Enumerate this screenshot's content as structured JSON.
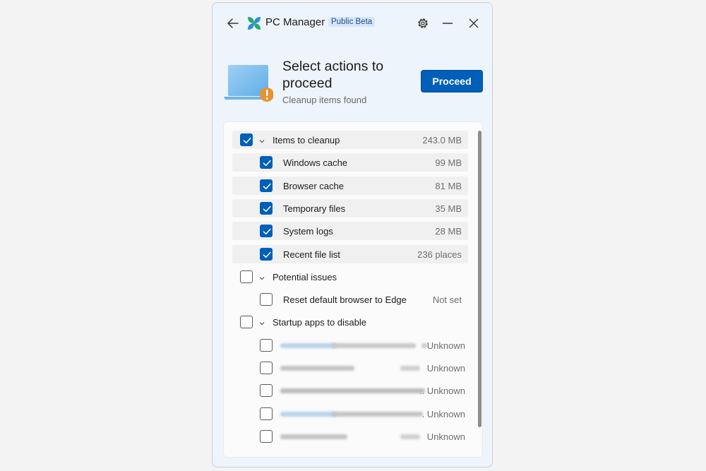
{
  "app": {
    "title": "PC Manager",
    "badge": "Public Beta"
  },
  "hero": {
    "title": "Select actions to proceed",
    "subtitle": "Cleanup items found",
    "proceed_label": "Proceed",
    "illustration_icon": "laptop-warning-icon"
  },
  "colors": {
    "accent": "#005fb8",
    "warning": "#e8932f",
    "window_bg": "#eef4fb"
  },
  "groups": [
    {
      "label": "Items to cleanup",
      "value": "243.0 MB",
      "checked": true,
      "items": [
        {
          "label": "Windows cache",
          "value": "99 MB",
          "checked": true
        },
        {
          "label": "Browser cache",
          "value": "81 MB",
          "checked": true
        },
        {
          "label": "Temporary files",
          "value": "35 MB",
          "checked": true
        },
        {
          "label": "System logs",
          "value": "28 MB",
          "checked": true
        },
        {
          "label": "Recent file list",
          "value": "236 places",
          "checked": true
        }
      ]
    },
    {
      "label": "Potential issues",
      "value": "",
      "checked": false,
      "items": [
        {
          "label": "Reset default browser to Edge",
          "value": "Not set",
          "checked": false
        }
      ]
    },
    {
      "label": "Startup apps to disable",
      "value": "",
      "checked": false,
      "items": [
        {
          "label": "",
          "value": "Unknown",
          "checked": false
        },
        {
          "label": "",
          "value": "Unknown",
          "checked": false
        },
        {
          "label": "",
          "value": ".. Unknown",
          "checked": false
        },
        {
          "label": "",
          "value": ". Unknown",
          "checked": false
        },
        {
          "label": "",
          "value": "Unknown",
          "checked": false
        }
      ]
    }
  ]
}
